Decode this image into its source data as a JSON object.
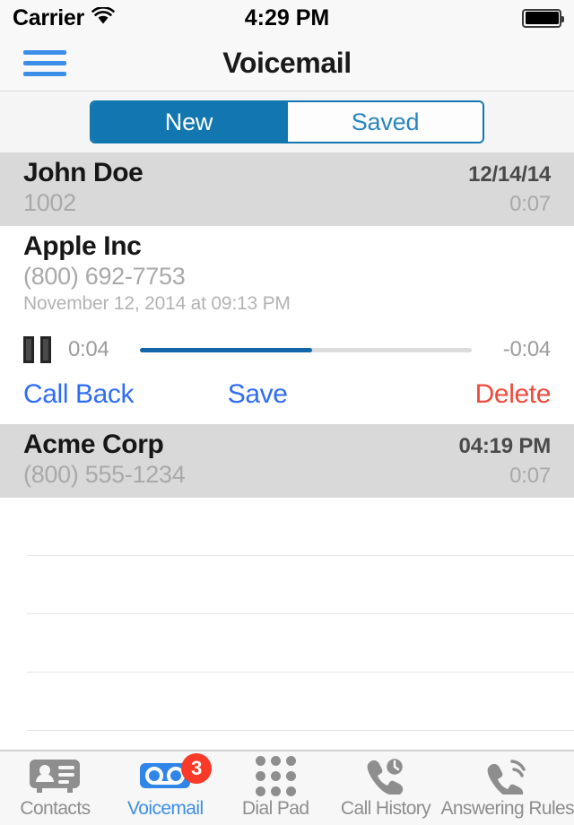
{
  "status_bar": {
    "carrier": "Carrier",
    "wifi_icon": "wifi-icon",
    "time": "4:29 PM",
    "battery_icon": "battery-full-icon"
  },
  "nav": {
    "menu_icon": "hamburger-menu-icon",
    "title": "Voicemail"
  },
  "segmented_control": {
    "options": [
      {
        "label": "New",
        "selected": true
      },
      {
        "label": "Saved",
        "selected": false
      }
    ],
    "selected_color": "#1277b0",
    "unselected_text_color": "#2a86bd"
  },
  "voicemails": [
    {
      "name": "John Doe",
      "number": "1002",
      "timestamp": "12/14/14",
      "duration": "0:07",
      "expanded": false,
      "highlighted": true
    },
    {
      "name": "Apple Inc",
      "number": "(800) 692-7753",
      "date_full": "November 12, 2014 at 09:13 PM",
      "expanded": true,
      "highlighted": false,
      "player": {
        "pause_icon": "pause-icon",
        "elapsed": "0:04",
        "remaining": "-0:04",
        "progress_percent": 52,
        "track_color": "#1266aa"
      },
      "actions": [
        {
          "label": "Call Back",
          "color": "#2f6df4"
        },
        {
          "label": "Save",
          "color": "#2f6df4"
        },
        {
          "label": "Delete",
          "color": "#ee4b3c"
        }
      ]
    },
    {
      "name": "Acme Corp",
      "number": "(800) 555-1234",
      "timestamp": "04:19 PM",
      "duration": "0:07",
      "expanded": false,
      "highlighted": true
    }
  ],
  "empty_rows": 5,
  "tabbar": {
    "items": [
      {
        "label": "Contacts",
        "icon": "contacts-card-icon",
        "active": false
      },
      {
        "label": "Voicemail",
        "icon": "voicemail-tape-icon",
        "active": true,
        "badge": "3"
      },
      {
        "label": "Dial Pad",
        "icon": "dialpad-grid-icon",
        "active": false
      },
      {
        "label": "Call History",
        "icon": "call-history-clock-icon",
        "active": false
      },
      {
        "label": "Answering Rules",
        "icon": "answering-rules-icon",
        "active": false
      }
    ],
    "active_color": "#3d8ee8",
    "inactive_color": "#8e8e8e",
    "badge_color": "#f93a28"
  }
}
